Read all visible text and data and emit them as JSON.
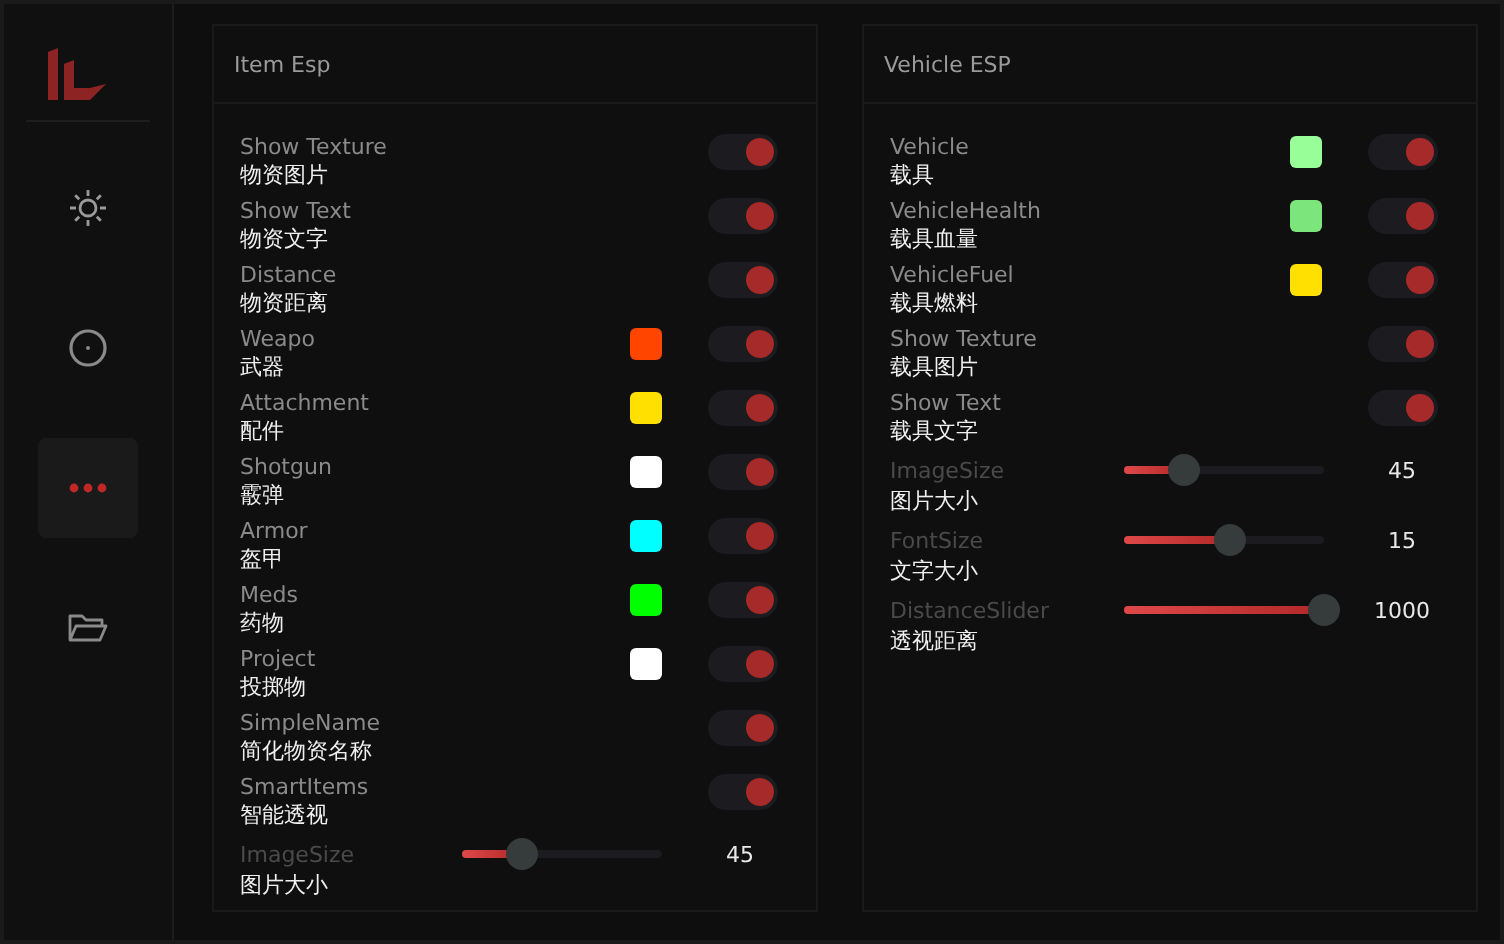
{
  "sidebar": {
    "items": [
      {
        "kind": "gear",
        "selected": false
      },
      {
        "kind": "target",
        "selected": false
      },
      {
        "kind": "more",
        "selected": true
      },
      {
        "kind": "folder",
        "selected": false
      }
    ]
  },
  "panels": [
    {
      "title": "Item Esp",
      "rows": [
        {
          "kind": "toggle",
          "label": "Show Texture",
          "sublabel": "物资图片",
          "on": true
        },
        {
          "kind": "toggle",
          "label": "Show Text",
          "sublabel": "物资文字",
          "on": true
        },
        {
          "kind": "toggle",
          "label": "Distance",
          "sublabel": "物资距离",
          "on": true
        },
        {
          "kind": "toggle",
          "label": "Weapo",
          "sublabel": "武器",
          "color": "#ff4500",
          "on": true
        },
        {
          "kind": "toggle",
          "label": "Attachment",
          "sublabel": "配件",
          "color": "#ffe000",
          "on": true
        },
        {
          "kind": "toggle",
          "label": "Shotgun",
          "sublabel": "霰弹",
          "color": "#ffffff",
          "on": true
        },
        {
          "kind": "toggle",
          "label": "Armor",
          "sublabel": "盔甲",
          "color": "#00ffff",
          "on": true
        },
        {
          "kind": "toggle",
          "label": "Meds",
          "sublabel": "药物",
          "color": "#00ff00",
          "on": true
        },
        {
          "kind": "toggle",
          "label": "Project",
          "sublabel": "投掷物",
          "color": "#ffffff",
          "on": true
        },
        {
          "kind": "toggle",
          "label": "SimpleName",
          "sublabel": "简化物资名称",
          "on": true
        },
        {
          "kind": "toggle",
          "label": "SmartItems",
          "sublabel": "智能透视",
          "on": true
        },
        {
          "kind": "slider",
          "label": "ImageSize",
          "sublabel": "图片大小",
          "level": 0.24,
          "value": "45"
        }
      ]
    },
    {
      "title": "Vehicle ESP",
      "rows": [
        {
          "kind": "toggle",
          "label": "Vehicle",
          "sublabel": "载具",
          "color": "#98ff98",
          "on": true
        },
        {
          "kind": "toggle",
          "label": "VehicleHealth",
          "sublabel": "载具血量",
          "color": "#7ce67c",
          "on": true
        },
        {
          "kind": "toggle",
          "label": "VehicleFuel",
          "sublabel": "载具燃料",
          "color": "#ffe000",
          "on": true
        },
        {
          "kind": "toggle",
          "label": "Show Texture",
          "sublabel": "载具图片",
          "on": true
        },
        {
          "kind": "toggle",
          "label": "Show Text",
          "sublabel": "载具文字",
          "on": true
        },
        {
          "kind": "slider",
          "label": "ImageSize",
          "sublabel": "图片大小",
          "level": 0.24,
          "value": "45"
        },
        {
          "kind": "slider",
          "label": "FontSize",
          "sublabel": "文字大小",
          "level": 0.49,
          "value": "15"
        },
        {
          "kind": "slider",
          "label": "DistanceSlider",
          "sublabel": "透视距离",
          "level": 1,
          "value": "1000"
        }
      ]
    }
  ]
}
